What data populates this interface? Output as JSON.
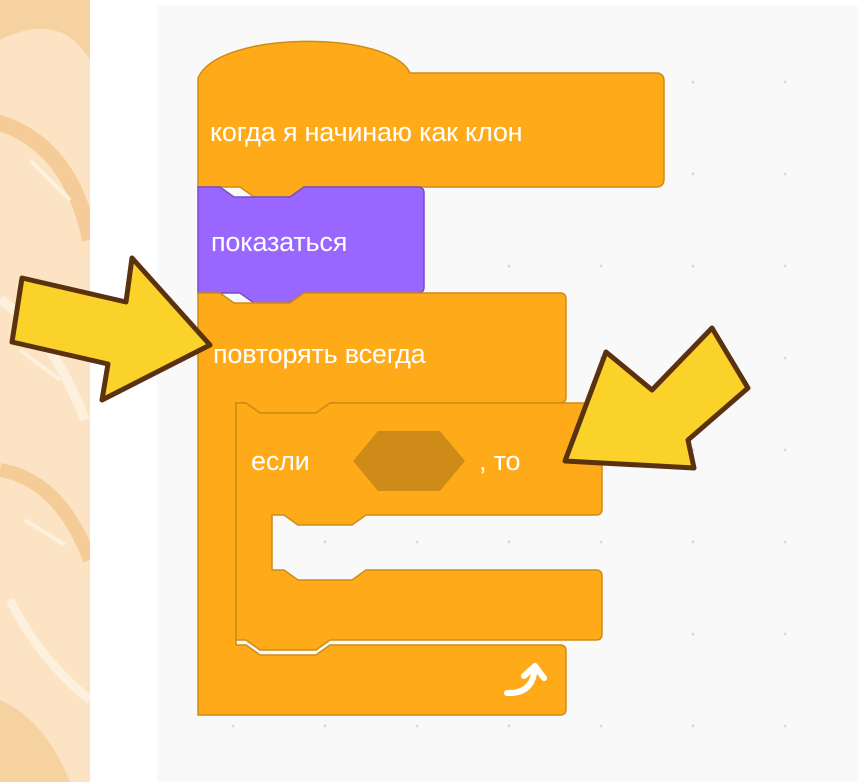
{
  "blocks": {
    "hat": {
      "label": "когда я начинаю как клон"
    },
    "show": {
      "label": "показаться"
    },
    "forever": {
      "label": "повторять всегда",
      "loop_icon": "loop-arrow-icon"
    },
    "if_then": {
      "label_if": "если",
      "label_then": ", то"
    }
  },
  "colors": {
    "control": "#ffab19",
    "control_border": "#cf8b17",
    "looks": "#9966ff",
    "looks_border": "#774dcb",
    "condition_slot": "#cf8b17",
    "arrow_fill": "#fbd22a",
    "arrow_stroke": "#5a3210",
    "canvas_bg": "#f9f9f9"
  },
  "arrows": [
    {
      "icon": "pointing-arrow-icon",
      "target": "forever-block"
    },
    {
      "icon": "pointing-arrow-icon",
      "target": "if-then-block"
    }
  ]
}
